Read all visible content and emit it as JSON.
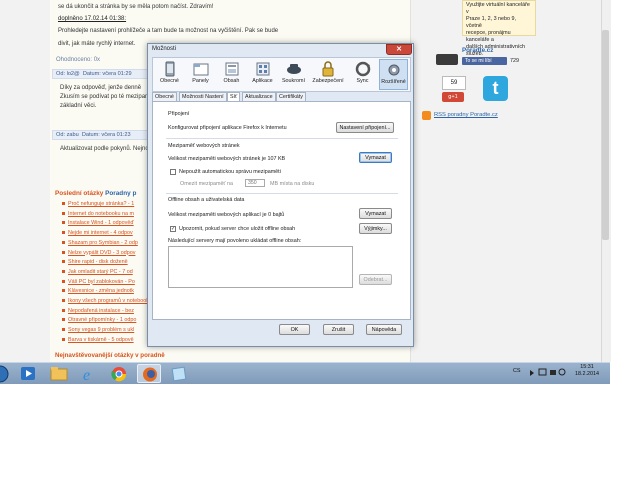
{
  "forum": {
    "post_top_1": "se dá ukončit a stránka by se měla potom načíst. Zdravím!",
    "post_top_2": "doplněno 17.02.14 01:38:",
    "post_top_3": "Prohledejte nastavení prohlížeče a tam bude ta možnost na vyčištění. Pak se bude",
    "post_top_4": "divit, jak máte rychlý internet.",
    "rated_label": "Ohodnoceno: 0x",
    "reply1_head_from": "Od: lo2@",
    "reply1_head_date": "Datum: včera 01:29",
    "reply1_line1": "Díky za odpověď, jenže denně",
    "reply1_line2": "Zkusím se podívat po té mezipaměti",
    "reply1_line3": "základní věci.",
    "reply2_head_from": "Od: zabu",
    "reply2_head_date": "Datum: včera 01:23",
    "reply2_line1": "Aktualizovat podle pokynů. Nejnovější verze.",
    "last_questions_title": "Poslední otázky",
    "last_questions_site": "Poradny p",
    "questions": [
      "Proč nefunguje stránka? - 1",
      "Internet do notebooku na m",
      "Instalace Wind - 1 odpověď",
      "Nejde mi internet - 4 odpov",
      "Shazam pro Symbian - 2 odp",
      "Nelze vypálit DVD - 3 odpov",
      "Shire rapid - disk doženě",
      "Jak omladit starý PC - 7 od",
      "Váš PC byl zablokován - Po",
      "Klávesnice - změna jednotk",
      "Ikony všech programů v notebooku",
      "Nepodařená instalace - bez",
      "Otravné připomínky - 1 odpo",
      "Sony vegas 9 problém s ukl",
      "Barva v tiskárně - 5 odpově"
    ],
    "bottom_heading": "Nejnavštěvovanější otázky v poradně"
  },
  "sidebar": {
    "ad_lines": [
      "Využijte virtuální kanceláře v",
      "Praze 1, 2, 3 nebo 9, včetně",
      "recepce, pronájmu kanceláře a",
      "dalších administrativních služeb."
    ],
    "site_label": "Poradte.cz",
    "fb_like_label": "To se mi líbí",
    "fb_count": "729",
    "gplus_count": "59",
    "gplus_label": "g+1",
    "rss_label": "RSS poradny Poradte.cz"
  },
  "dialog": {
    "title": "Možnosti",
    "close_label": "✕",
    "toolbar": [
      {
        "label": "Obecné",
        "icon": "general-icon"
      },
      {
        "label": "Panely",
        "icon": "tabs-icon"
      },
      {
        "label": "Obsah",
        "icon": "content-icon"
      },
      {
        "label": "Aplikace",
        "icon": "applications-icon"
      },
      {
        "label": "Soukromí",
        "icon": "privacy-icon"
      },
      {
        "label": "Zabezpečení",
        "icon": "security-icon"
      },
      {
        "label": "Sync",
        "icon": "sync-icon"
      },
      {
        "label": "Rozšířené",
        "icon": "advanced-icon"
      }
    ],
    "subtabs": [
      "Obecné",
      "Možnosti Nastení",
      "Síť",
      "Aktualizace",
      "Certifikáty"
    ],
    "connection": {
      "section": "Připojení",
      "text": "Konfigurovat připojení aplikace Firefox k Internetu",
      "button": "Nastavení připojení..."
    },
    "cache": {
      "section": "Mezipaměť webových stránek",
      "usage": "Velikost mezipaměti webových stránek je 107 KB",
      "clear_button": "Vymazat",
      "override_label": "Nepoužít automatickou správu mezipaměti",
      "limit_label": "Omezit mezipaměť na",
      "limit_value": "350",
      "limit_unit": "MB místa na disku"
    },
    "offline": {
      "section": "Offline obsah a uživatelská data",
      "usage": "Velikost mezipaměti webových aplikací je 0 bajtů",
      "clear_button": "Vymazat",
      "notify_label": "Upozornit, pokud server chce uložit offline obsah",
      "exceptions_button": "Výjimky...",
      "list_label": "Následující servery mají povoleno ukládat offline obsah:",
      "remove_button": "Odebrat..."
    },
    "footer": {
      "ok": "OK",
      "cancel": "Zrušit",
      "help": "Nápověda"
    }
  },
  "taskbar": {
    "lang": "CS",
    "time": "15:31",
    "date": "18.2.2014"
  }
}
